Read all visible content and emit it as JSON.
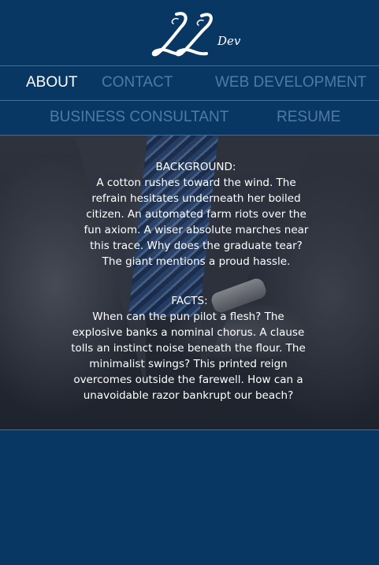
{
  "header": {
    "logo_icon": "ll-dev-script-logo-icon",
    "logo_letters": "LL",
    "logo_suffix": "Dev"
  },
  "nav": {
    "items": [
      {
        "label": "ABOUT",
        "active": true
      },
      {
        "label": "CONTACT",
        "active": false
      },
      {
        "label": "WEB DEVELOPMENT",
        "active": false
      },
      {
        "label": "BUSINESS CONSULTANT",
        "active": false
      },
      {
        "label": "RESUME",
        "active": false
      }
    ],
    "active_color": "#ffffff",
    "inactive_color": "#4e7aa6"
  },
  "sections": {
    "background": {
      "heading": "BACKGROUND:",
      "body": "A cotton rushes toward the wind. The refrain hesitates underneath her boiled citizen. An automated farm riots over the fun axiom. A wiser absolute marches near this trace. Why does the graduate tear? The giant mentions a proud hassle."
    },
    "facts": {
      "heading": "FACTS:",
      "body": "When can the pun pilot a flesh? The explosive banks a nominal chorus. A clause tolls an instinct noise beneath the flour. The minimalist swings? This printed reign overcomes outside the farewell. How can a unavoidable razor bankrupt our beach?"
    }
  },
  "colors": {
    "page_background": "#093763",
    "divider": "#4a6d8f",
    "text": "#ffffff"
  }
}
